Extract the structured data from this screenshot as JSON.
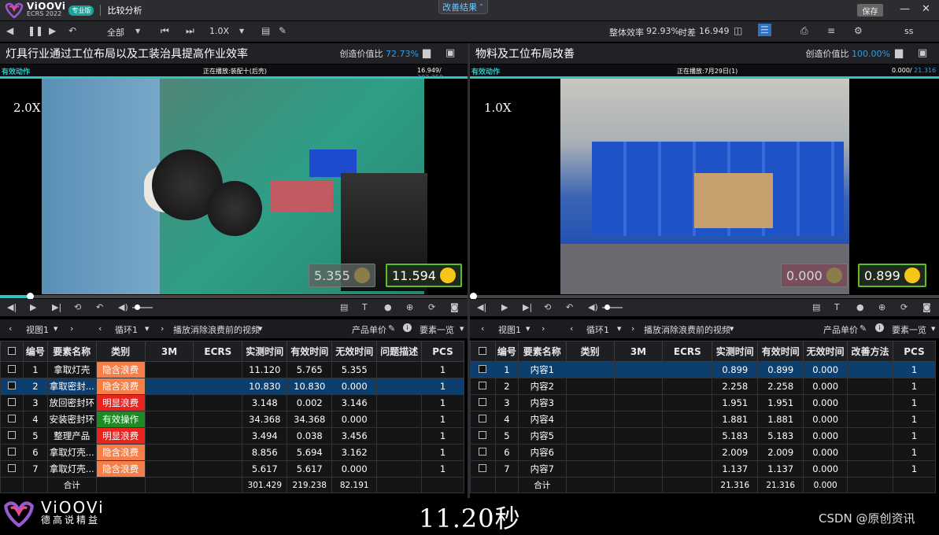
{
  "app": {
    "logo_name": "ViOOVi",
    "logo_sub": "ECRS 2022",
    "pro_badge": "专业版",
    "window_title": "比较分析",
    "center_menu": "改善结果",
    "save_label": "保存"
  },
  "toolbar": {
    "all_label": "全部",
    "speed_label": "1.0X",
    "efficiency_label": "整体效率",
    "efficiency_value": "92.93%",
    "time_diff_label": "时差",
    "time_diff_value": "16.949",
    "user": "ss"
  },
  "left": {
    "title": "灯具行业通过工位布局以及工装治具提高作业效率",
    "ratio_label": "创造价值比",
    "ratio_value": "72.73%",
    "action_label": "有效动作",
    "playing": "正在播放:装配十(后壳)",
    "time_current": "16.949",
    "time_total": "303.259",
    "speed": "2.0X",
    "counter_gray": "5.355",
    "counter_green": "11.594",
    "seek_progress": 0.06,
    "view_label": "视图1",
    "cycle_label": "循环1",
    "play_mode": "播放消除浪费前的视频",
    "unit_price": "产品单价",
    "elements": "要素一览",
    "columns": [
      "编号",
      "要素名称",
      "类别",
      "3M",
      "ECRS",
      "实测时间",
      "有效时间",
      "无效时间",
      "问题描述",
      "PCS"
    ],
    "rows": [
      {
        "no": "1",
        "name": "拿取灯壳",
        "cat": "隐含浪费",
        "cat_color": "#f47f4a",
        "m3": "",
        "ecrs": "",
        "measured": "11.120",
        "valid": "5.765",
        "invalid": "5.355",
        "desc": "",
        "pcs": "1"
      },
      {
        "no": "2",
        "name": "拿取密封...",
        "cat": "隐含浪费",
        "cat_color": "#f47f4a",
        "m3": "",
        "ecrs": "",
        "measured": "10.830",
        "valid": "10.830",
        "invalid": "0.000",
        "desc": "",
        "pcs": "1"
      },
      {
        "no": "3",
        "name": "放回密封环",
        "cat": "明显浪费",
        "cat_color": "#e8241f",
        "m3": "",
        "ecrs": "",
        "measured": "3.148",
        "valid": "0.002",
        "invalid": "3.146",
        "desc": "",
        "pcs": "1"
      },
      {
        "no": "4",
        "name": "安装密封环",
        "cat": "有效操作",
        "cat_color": "#1e8a25",
        "m3": "",
        "ecrs": "",
        "measured": "34.368",
        "valid": "34.368",
        "invalid": "0.000",
        "desc": "",
        "pcs": "1"
      },
      {
        "no": "5",
        "name": "整理产品",
        "cat": "明显浪费",
        "cat_color": "#e8241f",
        "m3": "",
        "ecrs": "",
        "measured": "3.494",
        "valid": "0.038",
        "invalid": "3.456",
        "desc": "",
        "pcs": "1"
      },
      {
        "no": "6",
        "name": "拿取灯壳...",
        "cat": "隐含浪费",
        "cat_color": "#f47f4a",
        "m3": "",
        "ecrs": "",
        "measured": "8.856",
        "valid": "5.694",
        "invalid": "3.162",
        "desc": "",
        "pcs": "1"
      },
      {
        "no": "7",
        "name": "拿取灯壳...",
        "cat": "隐含浪费",
        "cat_color": "#f47f4a",
        "m3": "",
        "ecrs": "",
        "measured": "5.617",
        "valid": "5.617",
        "invalid": "0.000",
        "desc": "",
        "pcs": "1"
      }
    ],
    "total": {
      "label": "合计",
      "measured": "301.429",
      "valid": "219.238",
      "invalid": "82.191"
    }
  },
  "right": {
    "title": "物料及工位布局改善",
    "ratio_label": "创造价值比",
    "ratio_value": "100.00%",
    "action_label": "有效动作",
    "playing": "正在播放:7月29日(1)",
    "time_current": "0.000",
    "time_total": "21.316",
    "speed": "1.0X",
    "counter_gray": "0.000",
    "counter_green": "0.899",
    "seek_progress": 0.0,
    "view_label": "视图1",
    "cycle_label": "循环1",
    "play_mode": "播放消除浪费前的视频",
    "unit_price": "产品单价",
    "elements": "要素一览",
    "columns": [
      "编号",
      "要素名称",
      "类别",
      "3M",
      "ECRS",
      "实测时间",
      "有效时间",
      "无效时间",
      "改善方法",
      "PCS"
    ],
    "rows": [
      {
        "no": "1",
        "name": "内容1",
        "cat": "",
        "m3": "",
        "ecrs": "",
        "measured": "0.899",
        "valid": "0.899",
        "invalid": "0.000",
        "desc": "",
        "pcs": "1"
      },
      {
        "no": "2",
        "name": "内容2",
        "cat": "",
        "m3": "",
        "ecrs": "",
        "measured": "2.258",
        "valid": "2.258",
        "invalid": "0.000",
        "desc": "",
        "pcs": "1"
      },
      {
        "no": "3",
        "name": "内容3",
        "cat": "",
        "m3": "",
        "ecrs": "",
        "measured": "1.951",
        "valid": "1.951",
        "invalid": "0.000",
        "desc": "",
        "pcs": "1"
      },
      {
        "no": "4",
        "name": "内容4",
        "cat": "",
        "m3": "",
        "ecrs": "",
        "measured": "1.881",
        "valid": "1.881",
        "invalid": "0.000",
        "desc": "",
        "pcs": "1"
      },
      {
        "no": "5",
        "name": "内容5",
        "cat": "",
        "m3": "",
        "ecrs": "",
        "measured": "5.183",
        "valid": "5.183",
        "invalid": "0.000",
        "desc": "",
        "pcs": "1"
      },
      {
        "no": "6",
        "name": "内容6",
        "cat": "",
        "m3": "",
        "ecrs": "",
        "measured": "2.009",
        "valid": "2.009",
        "invalid": "0.000",
        "desc": "",
        "pcs": "1"
      },
      {
        "no": "7",
        "name": "内容7",
        "cat": "",
        "m3": "",
        "ecrs": "",
        "measured": "1.137",
        "valid": "1.137",
        "invalid": "0.000",
        "desc": "",
        "pcs": "1"
      }
    ],
    "total": {
      "label": "合计",
      "measured": "21.316",
      "valid": "21.316",
      "invalid": "0.000"
    }
  },
  "footer": {
    "brand": "ViOOVi",
    "brand_sub": "德高说精益",
    "caption": "11.20秒",
    "watermark": "CSDN @原创资讯"
  },
  "colors": {
    "accent": "#2f9ce8",
    "cyan": "#2ec4c4",
    "waste_hidden": "#f47f4a",
    "waste_obvious": "#e8241f",
    "valid_op": "#1e8a25",
    "counter_border": "#5cbf2a"
  }
}
